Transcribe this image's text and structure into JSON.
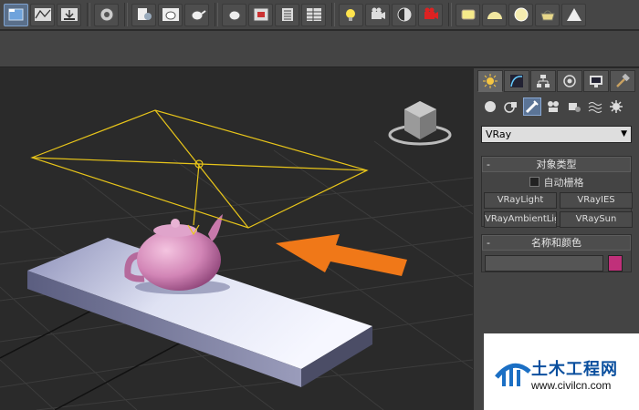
{
  "toolbar": {
    "buttons": [
      {
        "icon": "open-scene-icon",
        "active": true
      },
      {
        "icon": "curve-editor-icon"
      },
      {
        "icon": "download-icon"
      },
      {
        "icon": "render-setup-icon"
      },
      {
        "icon": "material-editor-icon"
      },
      {
        "icon": "teapot-icon"
      },
      {
        "icon": "teapot-render-icon"
      },
      {
        "icon": "teapot-icon"
      },
      {
        "icon": "picture-icon"
      },
      {
        "icon": "layers-icon"
      },
      {
        "icon": "table-icon"
      },
      {
        "icon": "light-bulb-icon"
      },
      {
        "icon": "camera-icon"
      },
      {
        "icon": "sphere-half-icon"
      },
      {
        "icon": "camera-red-icon"
      },
      {
        "icon": "plane-icon"
      },
      {
        "icon": "dome-icon"
      },
      {
        "icon": "sphere-icon"
      },
      {
        "icon": "basket-icon"
      },
      {
        "icon": "warning-icon"
      }
    ]
  },
  "panel": {
    "dropdown_value": "VRay",
    "object_type": {
      "title": "对象类型",
      "autogrid_label": "自动栅格",
      "buttons": [
        "VRayLight",
        "VRayIES",
        "VRayAmbientLigh",
        "VRaySun"
      ]
    },
    "name_color": {
      "title": "名称和颜色",
      "name_value": "",
      "color": "#c0307a"
    }
  },
  "colors": {
    "light_gizmo": "#e8c51a",
    "arrow": "#f07818",
    "teapot": "#d87fb4",
    "box_top": "#d8dcf0"
  },
  "watermark": {
    "title": "土木工程网",
    "url": "www.civilcn.com"
  }
}
